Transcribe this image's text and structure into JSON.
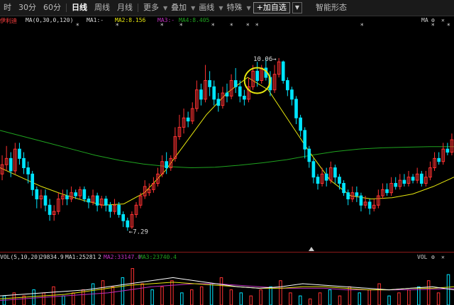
{
  "toolbar": {
    "items": [
      "时",
      "30分",
      "60分",
      "日线",
      "周线",
      "月线",
      "更多",
      "叠加",
      "画线",
      "特殊"
    ],
    "active_index": 3,
    "add_watch_label": "+加自选",
    "smart_shape_label": "智能形态"
  },
  "legend": {
    "name": "伊利迪",
    "ma_params": "MA(0,30,0,120)",
    "ma1": "MA1:-",
    "ma2": "MA2:8.156",
    "ma3": "MA3:-",
    "ma4": "MA4:8.405",
    "right_label": "MA"
  },
  "volume_legend": {
    "params": "VOL(5,10,20)",
    "vol": "29834.9",
    "ma1": "MA1:25281",
    "ma1_suffix": "2",
    "ma2": "MA2:33147.0",
    "ma3": "MA3:23740.4",
    "right_label": "VOL"
  },
  "colors": {
    "up": "#ff3232",
    "down": "#00e5ff",
    "ma_long": "#1fa31f",
    "ma_mid": "#e6e60e",
    "ma_vol_white": "#ffffff",
    "ma_vol_yellow": "#e6e60e",
    "ma_vol_magenta": "#c030c0",
    "highlight_circle": "#e6e60e"
  },
  "chart_data": {
    "type": "candlestick",
    "high_label": "10.06",
    "low_label": "7.29",
    "price_range": [
      7.1,
      10.4
    ],
    "candles": [
      [
        8.2,
        8.35,
        8.5,
        8.1
      ],
      [
        8.35,
        8.45,
        8.65,
        8.25
      ],
      [
        8.45,
        8.25,
        8.55,
        8.15
      ],
      [
        8.25,
        8.6,
        8.7,
        8.2
      ],
      [
        8.6,
        8.45,
        8.7,
        8.35
      ],
      [
        8.45,
        8.3,
        8.55,
        8.2
      ],
      [
        8.3,
        8.2,
        8.4,
        8.05
      ],
      [
        8.2,
        7.95,
        8.25,
        7.85
      ],
      [
        7.95,
        7.8,
        8.0,
        7.65
      ],
      [
        7.8,
        7.85,
        7.95,
        7.65
      ],
      [
        7.85,
        7.7,
        7.95,
        7.6
      ],
      [
        7.7,
        7.55,
        7.8,
        7.45
      ],
      [
        7.55,
        7.6,
        7.7,
        7.45
      ],
      [
        7.6,
        7.8,
        7.9,
        7.55
      ],
      [
        7.8,
        7.85,
        7.95,
        7.7
      ],
      [
        7.85,
        7.8,
        7.95,
        7.7
      ],
      [
        7.8,
        7.9,
        8.0,
        7.75
      ],
      [
        7.9,
        7.85,
        7.95,
        7.8
      ],
      [
        7.85,
        7.95,
        8.0,
        7.8
      ],
      [
        7.95,
        7.8,
        8.0,
        7.75
      ],
      [
        7.8,
        7.75,
        7.85,
        7.65
      ],
      [
        7.75,
        7.85,
        7.95,
        7.7
      ],
      [
        7.85,
        7.7,
        7.9,
        7.6
      ],
      [
        7.7,
        7.8,
        7.85,
        7.65
      ],
      [
        7.8,
        7.7,
        7.85,
        7.6
      ],
      [
        7.7,
        7.6,
        7.75,
        7.5
      ],
      [
        7.6,
        7.7,
        7.8,
        7.55
      ],
      [
        7.7,
        7.55,
        7.75,
        7.5
      ],
      [
        7.55,
        7.45,
        7.6,
        7.35
      ],
      [
        7.45,
        7.35,
        7.5,
        7.29
      ],
      [
        7.35,
        7.55,
        7.6,
        7.32
      ],
      [
        7.55,
        7.7,
        7.75,
        7.5
      ],
      [
        7.7,
        7.85,
        7.9,
        7.65
      ],
      [
        7.85,
        8.0,
        8.1,
        7.8
      ],
      [
        7.9,
        7.95,
        8.05,
        7.85
      ],
      [
        7.95,
        8.05,
        8.15,
        7.9
      ],
      [
        8.05,
        8.2,
        8.3,
        8.0
      ],
      [
        8.2,
        8.4,
        8.5,
        8.15
      ],
      [
        8.4,
        8.3,
        8.55,
        8.2
      ],
      [
        8.3,
        8.45,
        8.5,
        8.25
      ],
      [
        8.45,
        8.8,
        8.95,
        8.4
      ],
      [
        8.8,
        8.95,
        9.15,
        8.75
      ],
      [
        8.95,
        9.1,
        9.25,
        8.85
      ],
      [
        9.1,
        9.05,
        9.2,
        8.95
      ],
      [
        9.05,
        9.25,
        9.35,
        9.0
      ],
      [
        9.25,
        9.55,
        9.7,
        9.2
      ],
      [
        9.55,
        9.4,
        9.65,
        9.3
      ],
      [
        9.4,
        9.7,
        9.95,
        9.35
      ],
      [
        9.7,
        9.6,
        9.85,
        9.45
      ],
      [
        9.6,
        9.4,
        9.7,
        9.3
      ],
      [
        9.4,
        9.3,
        9.5,
        9.2
      ],
      [
        9.3,
        9.5,
        9.6,
        9.25
      ],
      [
        9.5,
        9.45,
        9.65,
        9.35
      ],
      [
        9.45,
        9.7,
        9.8,
        9.4
      ],
      [
        9.7,
        9.6,
        9.9,
        9.5
      ],
      [
        9.6,
        9.45,
        9.7,
        9.35
      ],
      [
        9.45,
        9.4,
        9.55,
        9.3
      ],
      [
        9.4,
        9.6,
        9.75,
        9.35
      ],
      [
        9.6,
        9.85,
        9.95,
        9.55
      ],
      [
        9.85,
        9.7,
        10.0,
        9.6
      ],
      [
        9.7,
        9.9,
        9.95,
        9.65
      ],
      [
        9.9,
        9.75,
        10.05,
        9.7
      ],
      [
        9.75,
        9.55,
        9.85,
        9.45
      ],
      [
        9.55,
        9.8,
        9.95,
        9.5
      ],
      [
        9.8,
        10.0,
        10.06,
        9.75
      ],
      [
        10.0,
        9.7,
        10.02,
        9.65
      ],
      [
        9.7,
        9.55,
        9.75,
        9.45
      ],
      [
        9.55,
        9.4,
        9.6,
        9.3
      ],
      [
        9.4,
        9.1,
        9.45,
        9.0
      ],
      [
        9.1,
        8.9,
        9.15,
        8.8
      ],
      [
        8.9,
        8.6,
        8.95,
        8.45
      ],
      [
        8.6,
        8.4,
        8.65,
        8.3
      ],
      [
        8.4,
        8.15,
        8.45,
        8.05
      ],
      [
        8.15,
        8.05,
        8.2,
        7.95
      ],
      [
        8.05,
        8.2,
        8.3,
        8.0
      ],
      [
        8.2,
        8.1,
        8.3,
        8.0
      ],
      [
        8.1,
        8.3,
        8.4,
        8.05
      ],
      [
        8.3,
        8.15,
        8.35,
        8.05
      ],
      [
        8.15,
        8.05,
        8.2,
        7.95
      ],
      [
        8.05,
        7.9,
        8.1,
        7.85
      ],
      [
        7.9,
        7.8,
        7.95,
        7.7
      ],
      [
        7.8,
        7.9,
        8.0,
        7.75
      ],
      [
        7.9,
        7.85,
        8.0,
        7.75
      ],
      [
        7.85,
        7.7,
        7.9,
        7.6
      ],
      [
        7.7,
        7.75,
        7.85,
        7.65
      ],
      [
        7.75,
        7.65,
        7.8,
        7.55
      ],
      [
        7.65,
        7.7,
        7.8,
        7.6
      ],
      [
        7.7,
        7.85,
        7.95,
        7.65
      ],
      [
        7.85,
        7.95,
        8.05,
        7.8
      ],
      [
        7.95,
        7.9,
        8.05,
        7.85
      ],
      [
        7.9,
        8.05,
        8.15,
        7.85
      ],
      [
        8.05,
        8.0,
        8.15,
        7.95
      ],
      [
        8.0,
        8.1,
        8.2,
        7.95
      ],
      [
        8.1,
        8.05,
        8.2,
        8.0
      ],
      [
        8.05,
        8.15,
        8.25,
        8.0
      ],
      [
        8.15,
        8.1,
        8.2,
        8.05
      ],
      [
        8.1,
        8.2,
        8.3,
        8.05
      ],
      [
        8.2,
        8.05,
        8.25,
        8.0
      ],
      [
        8.05,
        8.15,
        8.25,
        8.0
      ],
      [
        8.15,
        8.3,
        8.4,
        8.1
      ],
      [
        8.3,
        8.45,
        8.55,
        8.25
      ],
      [
        8.45,
        8.4,
        8.55,
        8.35
      ],
      [
        8.4,
        8.6,
        8.7,
        8.35
      ],
      [
        8.6,
        8.55,
        8.7,
        8.5
      ],
      [
        8.55,
        8.75,
        8.85,
        8.5
      ]
    ],
    "ma_long": [
      8.9,
      8.8,
      8.7,
      8.6,
      8.5,
      8.42,
      8.36,
      8.32,
      8.3,
      8.31,
      8.34,
      8.38,
      8.43,
      8.5,
      8.56,
      8.6,
      8.62,
      8.63,
      8.64,
      8.64
    ],
    "ma_mid": [
      8.3,
      8.15,
      8.0,
      7.88,
      7.78,
      7.7,
      7.72,
      7.9,
      8.25,
      8.7,
      9.15,
      9.5,
      9.75,
      9.55,
      9.05,
      8.55,
      8.1,
      7.85,
      7.8,
      7.82,
      7.88,
      8.0,
      8.15
    ],
    "volume": [
      3,
      4,
      3,
      5,
      4,
      6,
      3,
      4,
      5,
      7,
      8,
      6,
      9,
      12,
      7,
      5,
      6,
      8,
      4,
      5,
      6,
      7,
      9,
      5,
      4,
      3,
      5,
      6,
      8,
      4,
      3,
      2,
      4,
      5,
      3,
      6,
      4,
      5,
      7,
      3,
      4,
      5,
      6,
      8,
      4,
      10
    ],
    "volume_ma_white": [
      3,
      3.5,
      4,
      4.5,
      5,
      6,
      7,
      8,
      9,
      8,
      7,
      6,
      5.5,
      6,
      7,
      6.5,
      6,
      5.5,
      5,
      5.5,
      6,
      5
    ],
    "volume_ma_yellow": [
      2,
      2.5,
      3,
      3.5,
      4.5,
      5.5,
      6.5,
      7,
      7.5,
      7,
      6.5,
      6,
      5.5,
      5.5,
      6,
      6,
      5.5,
      5,
      5,
      5.5,
      5.5,
      6
    ],
    "volume_ma_magenta": [
      1.5,
      2,
      2.5,
      3,
      3.5,
      4,
      5,
      6,
      6.5,
      7,
      7,
      6.5,
      6,
      5.5,
      5.5,
      5.5,
      5,
      5,
      5,
      5,
      5.2,
      5.4
    ]
  }
}
